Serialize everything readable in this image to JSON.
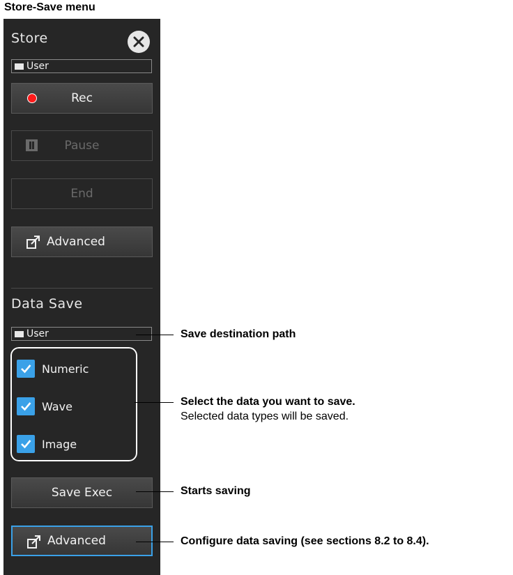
{
  "caption": "Store-Save menu",
  "store": {
    "title": "Store",
    "path": "User",
    "rec_label": "Rec",
    "pause_label": "Pause",
    "end_label": "End",
    "advanced_label": "Advanced"
  },
  "data_save": {
    "title": "Data Save",
    "path": "User",
    "checks": [
      {
        "label": "Numeric",
        "checked": true
      },
      {
        "label": "Wave",
        "checked": true
      },
      {
        "label": "Image",
        "checked": true
      }
    ],
    "save_exec_label": "Save Exec",
    "advanced_label": "Advanced"
  },
  "annotations": {
    "path": "Save destination path",
    "select_title": "Select the data you want to save.",
    "select_desc": "Selected data types will be saved.",
    "save_exec": "Starts saving",
    "advanced": "Configure data saving (see sections 8.2 to 8.4)."
  },
  "colors": {
    "panel_bg": "#262626",
    "accent": "#3aa1e8",
    "rec": "#ff1a1a"
  }
}
